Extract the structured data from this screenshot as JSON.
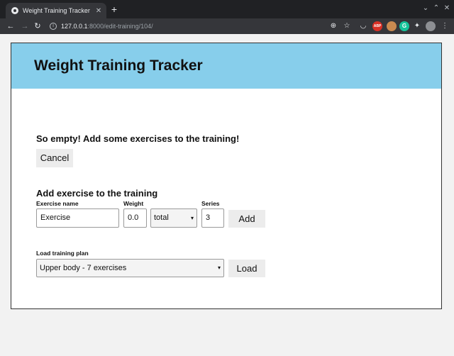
{
  "browser": {
    "tab_title": "Weight Training Tracker",
    "tab_close": "✕",
    "new_tab": "+",
    "url_host": "127.0.0.1",
    "url_path": ":8000/edit-training/104/",
    "abp_label": "ABP",
    "g_label": "G"
  },
  "app": {
    "title": "Weight Training Tracker"
  },
  "training": {
    "empty_message": "So empty! Add some exercises to the training!",
    "cancel_label": "Cancel"
  },
  "add_exercise": {
    "heading": "Add exercise to the training",
    "name_label": "Exercise name",
    "name_value": "Exercise",
    "weight_label": "Weight",
    "weight_value": "0.0",
    "weight_mode_selected": "total",
    "series_label": "Series",
    "series_value": "3",
    "add_label": "Add"
  },
  "load_plan": {
    "label": "Load training plan",
    "selected_plan": "Upper body - 7 exercises",
    "load_label": "Load"
  },
  "colors": {
    "header_bg": "#87ceeb",
    "button_bg": "#ececec",
    "chrome_dark": "#202124",
    "chrome_toolbar": "#35363a"
  }
}
